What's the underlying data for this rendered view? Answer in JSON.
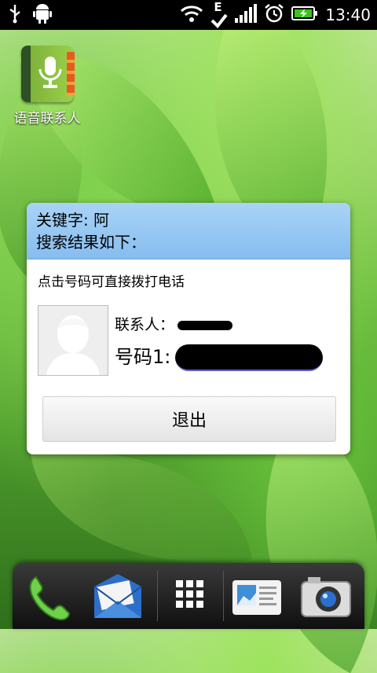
{
  "status_bar": {
    "time": "13:40",
    "left_icons": [
      "usb-icon",
      "android-debug-icon"
    ],
    "right_icons": [
      "wifi-icon",
      "edge-signal-icon",
      "signal-bars-icon",
      "alarm-icon",
      "battery-charging-icon"
    ],
    "network_letter": "E"
  },
  "desktop": {
    "shortcut_label": "语音联系人"
  },
  "dialog": {
    "keyword_label": "关键字: 阿",
    "results_label": "搜索结果如下：",
    "hint": "点击号码可直接拨打电话",
    "contact_label": "联系人：",
    "number_label": "号码1:",
    "exit_label": "退出"
  },
  "dock": {
    "items": [
      "phone-icon",
      "messages-icon",
      "all-apps-icon",
      "people-card-icon",
      "camera-icon"
    ]
  },
  "colors": {
    "dialog_header": "#86bdf0",
    "dock": "#1a1a1a",
    "status_bar": "#000000"
  }
}
